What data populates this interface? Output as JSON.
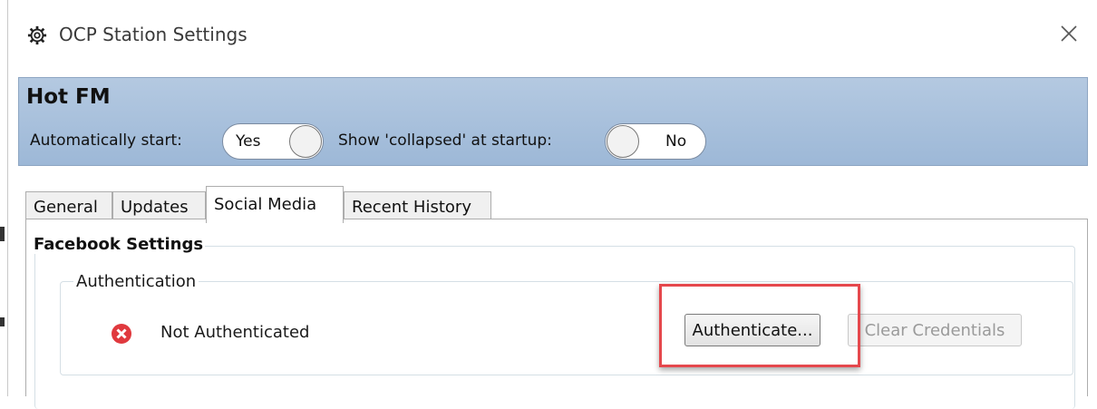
{
  "window": {
    "title": "OCP Station Settings",
    "title_icon": "gear-icon",
    "close_icon": "close-icon"
  },
  "header": {
    "station_name": "Hot FM",
    "auto_start_label": "Automatically start:",
    "auto_start_value": "Yes",
    "collapsed_label": "Show 'collapsed' at startup:",
    "collapsed_value": "No",
    "background_color": "#a8c0dc"
  },
  "tabs": [
    {
      "label": "General"
    },
    {
      "label": "Updates"
    },
    {
      "label": "Social Media",
      "active": true
    },
    {
      "label": "Recent History"
    }
  ],
  "facebook": {
    "group_title": "Facebook Settings",
    "auth_group_title": "Authentication",
    "status_icon": "error-icon",
    "status_text": "Not Authenticated",
    "authenticate_label": "Authenticate...",
    "clear_label": "Clear Credentials",
    "clear_enabled": false
  },
  "annotation": {
    "highlight_color": "#e5484d"
  }
}
